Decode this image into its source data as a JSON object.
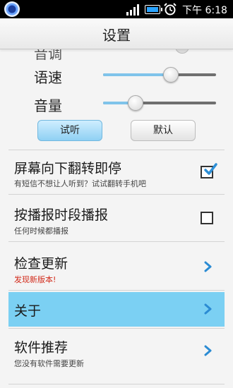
{
  "status_bar": {
    "time": "下午 6:18",
    "app_icon": "camera-lens-icon",
    "signal_icon": "signal-bars-icon",
    "battery_icon": "battery-icon",
    "alarm_icon": "alarm-clock-icon"
  },
  "title": "设置",
  "partial_item": {
    "label": "音调"
  },
  "sliders": [
    {
      "label": "语速",
      "value": 0.6
    },
    {
      "label": "音量",
      "value": 0.29
    }
  ],
  "buttons": {
    "test": "试听",
    "default": "默认"
  },
  "settings": [
    {
      "title": "屏幕向下翻转即停",
      "subtitle": "有短信不想让人听到？试试翻转手机吧",
      "control": "checkbox",
      "checked": true
    },
    {
      "title": "按播报时段播报",
      "subtitle": "任何时候都播报",
      "control": "checkbox",
      "checked": false
    },
    {
      "title": "检查更新",
      "subtitle": "发现新版本!",
      "subtitle_color": "#d22a1a",
      "control": "chevron"
    },
    {
      "title": "关于",
      "subtitle": "",
      "control": "chevron",
      "selected": true
    },
    {
      "title": "软件推荐",
      "subtitle": "您没有软件需要更新",
      "control": "chevron"
    }
  ],
  "colors": {
    "accent": "#7bd0f3",
    "slider_fill": "#7fc3ea",
    "check": "#2e8fd6",
    "chevron": "#2b8bd3",
    "update_text": "#d22a1a"
  }
}
